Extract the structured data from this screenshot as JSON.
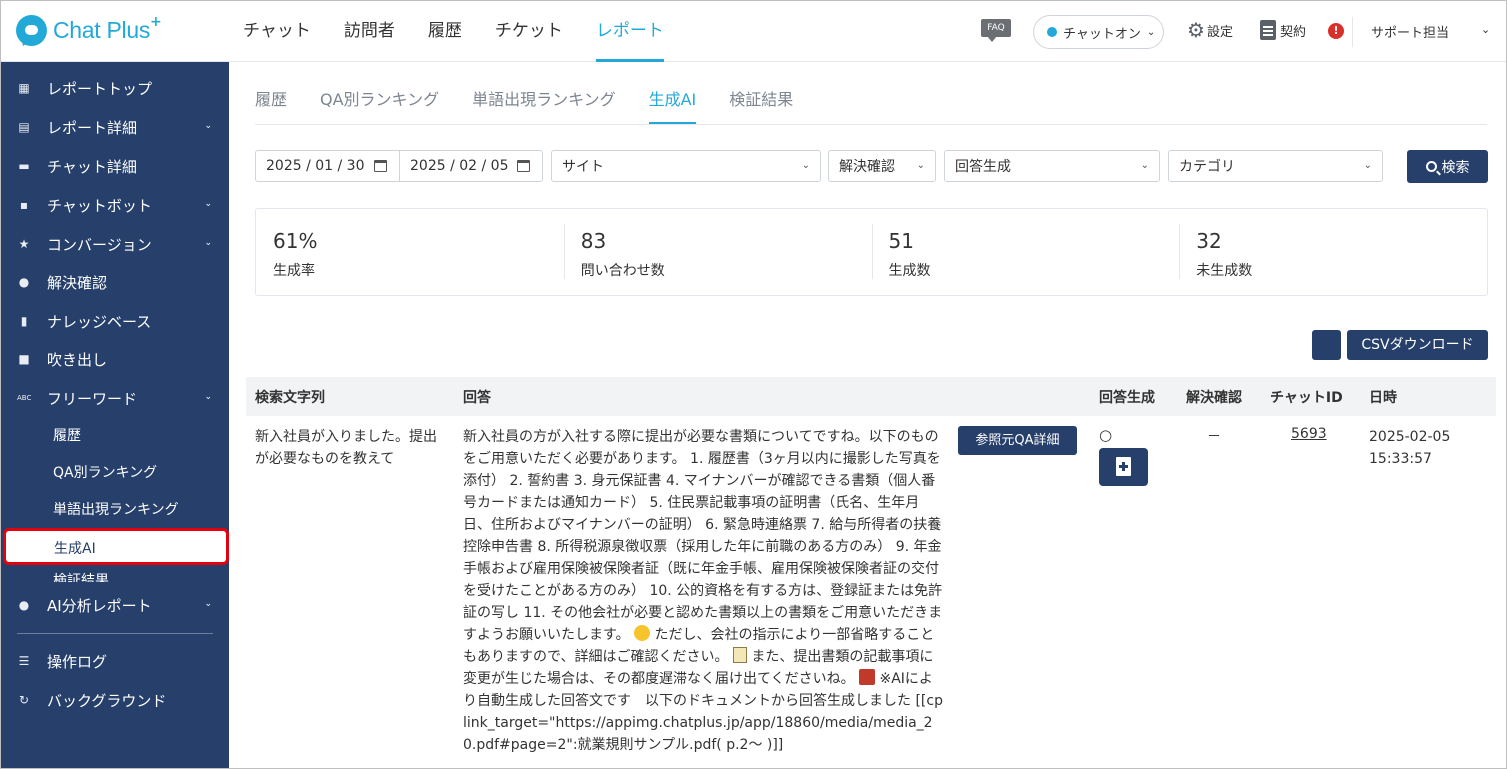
{
  "logo": {
    "text": "Chat Plus",
    "plus": "+"
  },
  "topnav": [
    "チャット",
    "訪問者",
    "履歴",
    "チケット",
    "レポート"
  ],
  "topbar": {
    "faq": "FAQ",
    "chat_status": "チャットオン",
    "settings": "設定",
    "contract": "契約",
    "alert": "!",
    "user": "サポート担当"
  },
  "sidebar": {
    "items": [
      {
        "label": "レポートトップ"
      },
      {
        "label": "レポート詳細"
      },
      {
        "label": "チャット詳細"
      },
      {
        "label": "チャットボット"
      },
      {
        "label": "コンバージョン"
      },
      {
        "label": "解決確認"
      },
      {
        "label": "ナレッジベース"
      },
      {
        "label": "吹き出し"
      },
      {
        "label": "フリーワード"
      }
    ],
    "sub": [
      "履歴",
      "QA別ランキング",
      "単語出現ランキング",
      "生成AI",
      "検証結果"
    ],
    "bottom": [
      {
        "label": "AI分析レポート"
      },
      {
        "label": "操作ログ"
      },
      {
        "label": "バックグラウンド"
      }
    ]
  },
  "tabs": [
    "履歴",
    "QA別ランキング",
    "単語出現ランキング",
    "生成AI",
    "検証結果"
  ],
  "filters": {
    "date_from": "2025 / 01 / 30",
    "date_to": "2025 / 02 / 05",
    "site": "サイト",
    "resolution": "解決確認",
    "answer_gen": "回答生成",
    "category": "カテゴリ",
    "search": "検索"
  },
  "stats": [
    {
      "value": "61%",
      "label": "生成率"
    },
    {
      "value": "83",
      "label": "問い合わせ数"
    },
    {
      "value": "51",
      "label": "生成数"
    },
    {
      "value": "32",
      "label": "未生成数"
    }
  ],
  "csv_button": "CSVダウンロード",
  "table": {
    "headers": [
      "検索文字列",
      "回答",
      "回答生成",
      "解決確認",
      "チャットID",
      "日時"
    ],
    "row": {
      "query": "新入社員が入りました。提出が必要なものを教えて",
      "answer_p1": "新入社員の方が入社する際に提出が必要な書類についてですね。以下のものをご用意いただく必要があります。 1. 履歴書（3ヶ月以内に撮影した写真を添付） 2. 誓約書 3. 身元保証書 4. マイナンバーが確認できる書類（個人番号カードまたは通知カード） 5. 住民票記載事項の証明書（氏名、生年月日、住所およびマイナンバーの証明） 6. 緊急時連絡票 7. 給与所得者の扶養控除申告書 8. 所得税源泉徴収票（採用した年に前職のある方のみ） 9. 年金手帳および雇用保険被保険者証（既に年金手帳、雇用保険被保険者証の交付を受けたことがある方のみ） 10. 公的資格を有する方は、登録証または免許証の写し 11. その他会社が必要と認めた書類以上の書類をご用意いただきますようお願いいたします。",
      "answer_p2": " ただし、会社の指示により一部省略することもありますので、詳細はご確認ください。",
      "answer_p3": " また、提出書類の記載事項に変更が生じた場合は、その都度遅滞なく届け出てくださいね。",
      "answer_p4": " ※AIにより自動生成した回答文です　以下のドキュメントから回答生成しました [[cplink_target=\"https://appimg.chatplus.jp/app/18860/media/media_20.pdf#page=2\":就業規則サンプル.pdf( p.2～ )]]",
      "ref_button": "参照元QA詳細",
      "generated": "○",
      "resolved": "－",
      "chat_id": "5693",
      "date": "2025-02-05",
      "time": "15:33:57"
    }
  },
  "colors": {
    "brand": "#23a9d8",
    "sidebar": "#263f6b",
    "highlight": "#e3000f"
  }
}
